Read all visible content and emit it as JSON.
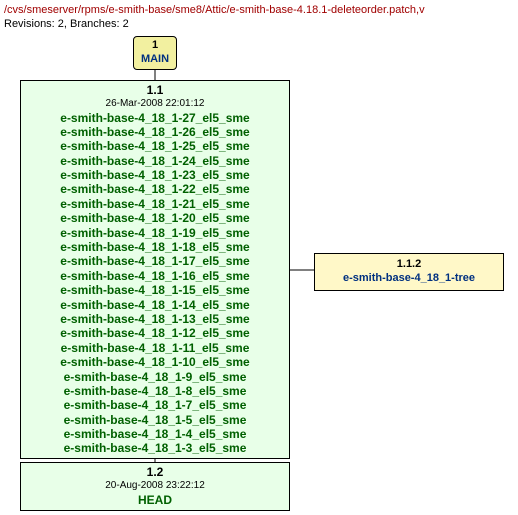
{
  "path": "/cvs/smeserver/rpms/e-smith-base/sme8/Attic/e-smith-base-4.18.1-deleteorder.patch,v",
  "summary": "Revisions: 2, Branches: 2",
  "main": {
    "number": "1",
    "label": "MAIN"
  },
  "rev11": {
    "version": "1.1",
    "date": "26-Mar-2008 22:01:12",
    "tags": [
      "e-smith-base-4_18_1-27_el5_sme",
      "e-smith-base-4_18_1-26_el5_sme",
      "e-smith-base-4_18_1-25_el5_sme",
      "e-smith-base-4_18_1-24_el5_sme",
      "e-smith-base-4_18_1-23_el5_sme",
      "e-smith-base-4_18_1-22_el5_sme",
      "e-smith-base-4_18_1-21_el5_sme",
      "e-smith-base-4_18_1-20_el5_sme",
      "e-smith-base-4_18_1-19_el5_sme",
      "e-smith-base-4_18_1-18_el5_sme",
      "e-smith-base-4_18_1-17_el5_sme",
      "e-smith-base-4_18_1-16_el5_sme",
      "e-smith-base-4_18_1-15_el5_sme",
      "e-smith-base-4_18_1-14_el5_sme",
      "e-smith-base-4_18_1-13_el5_sme",
      "e-smith-base-4_18_1-12_el5_sme",
      "e-smith-base-4_18_1-11_el5_sme",
      "e-smith-base-4_18_1-10_el5_sme",
      "e-smith-base-4_18_1-9_el5_sme",
      "e-smith-base-4_18_1-8_el5_sme",
      "e-smith-base-4_18_1-7_el5_sme",
      "e-smith-base-4_18_1-5_el5_sme",
      "e-smith-base-4_18_1-4_el5_sme",
      "e-smith-base-4_18_1-3_el5_sme"
    ]
  },
  "rev12": {
    "version": "1.2",
    "date": "20-Aug-2008 23:22:12",
    "head": "HEAD"
  },
  "branch": {
    "version": "1.1.2",
    "name": "e-smith-base-4_18_1-tree"
  },
  "chart_data": {
    "type": "diagram",
    "description": "CVS revision graph",
    "nodes": [
      {
        "id": "MAIN",
        "label": "1 MAIN",
        "kind": "trunk-root"
      },
      {
        "id": "1.1",
        "date": "26-Mar-2008 22:01:12",
        "tag_count": 24,
        "kind": "revision"
      },
      {
        "id": "1.2",
        "date": "20-Aug-2008 23:22:12",
        "kind": "revision-head"
      },
      {
        "id": "1.1.2",
        "label": "e-smith-base-4_18_1-tree",
        "kind": "branch"
      }
    ],
    "edges": [
      {
        "from": "MAIN",
        "to": "1.1"
      },
      {
        "from": "1.1",
        "to": "1.2"
      },
      {
        "from": "1.1",
        "to": "1.1.2"
      }
    ]
  }
}
